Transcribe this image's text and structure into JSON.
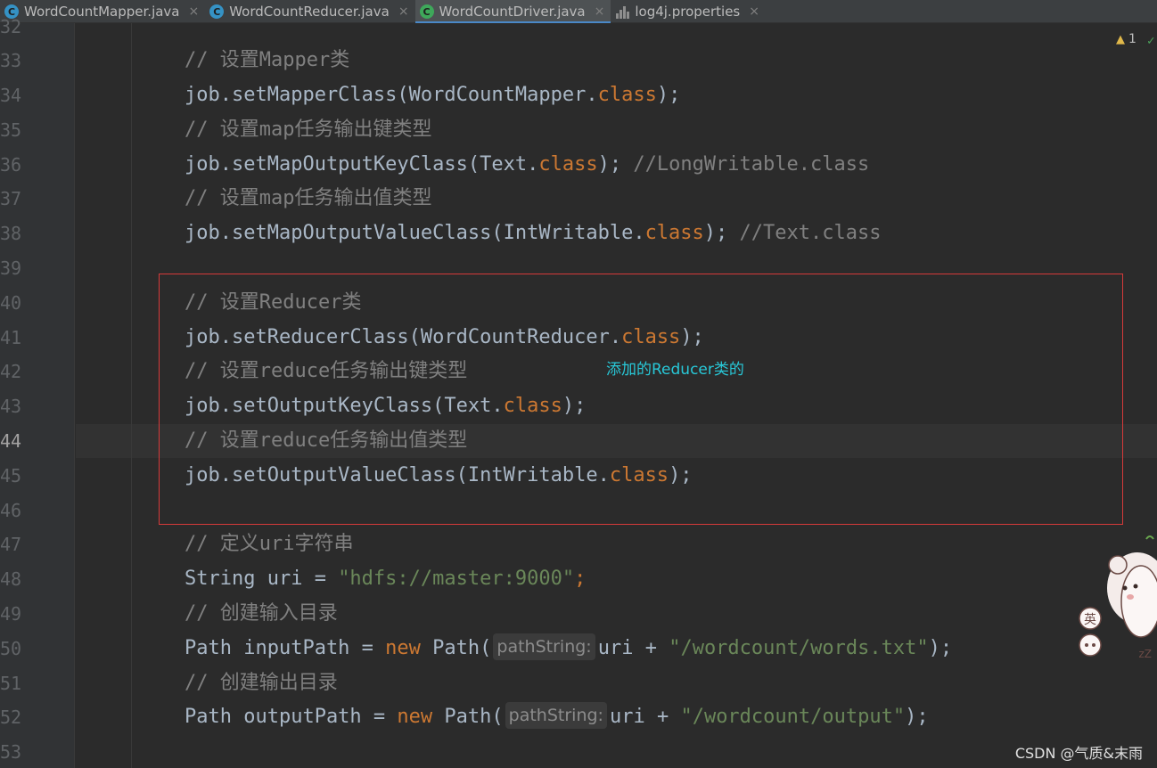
{
  "tabs": [
    {
      "label": "WordCountMapper.java",
      "icon": "C",
      "close": "×"
    },
    {
      "label": "WordCountReducer.java",
      "icon": "C",
      "close": "×"
    },
    {
      "label": "WordCountDriver.java",
      "icon": "C",
      "close": "×",
      "active": true
    },
    {
      "label": "log4j.properties",
      "icon": "properties-file-icon",
      "close": "×"
    }
  ],
  "inspections": {
    "warning_count": "1"
  },
  "gutter": {
    "line_numbers": [
      "32",
      "33",
      "34",
      "35",
      "36",
      "37",
      "38",
      "39",
      "40",
      "41",
      "42",
      "43",
      "44",
      "45",
      "46",
      "47",
      "48",
      "49",
      "50",
      "51",
      "52",
      "53"
    ]
  },
  "code": {
    "l33": {
      "comment": "// 设置Mapper类"
    },
    "l34": {
      "pre": "job.setMapperClass(WordCountMapper.",
      "kw": "class",
      "post": ");"
    },
    "l35": {
      "comment": "// 设置map任务输出键类型"
    },
    "l36": {
      "pre": "job.setMapOutputKeyClass(Text.",
      "kw": "class",
      "post": ");",
      "trail": " //LongWritable.class"
    },
    "l37": {
      "comment": "// 设置map任务输出值类型"
    },
    "l38": {
      "pre": "job.setMapOutputValueClass(IntWritable.",
      "kw": "class",
      "post": ");",
      "trail": " //Text.class"
    },
    "l40": {
      "comment": "// 设置Reducer类"
    },
    "l41": {
      "pre": "job.setReducerClass(WordCountReducer.",
      "kw": "class",
      "post": ");"
    },
    "l42": {
      "comment": "// 设置reduce任务输出键类型"
    },
    "l43": {
      "pre": "job.setOutputKeyClass(Text.",
      "kw": "class",
      "post": ");"
    },
    "l44": {
      "comment": "// 设置reduce任务输出值类型"
    },
    "l45": {
      "pre": "job.setOutputValueClass(IntWritable.",
      "kw": "class",
      "post": ");"
    },
    "l47": {
      "comment": "// 定义uri字符串"
    },
    "l48": {
      "pre": "String uri = ",
      "str": "\"hdfs://master:9000\"",
      "post": ";"
    },
    "l49": {
      "comment": "// 创建输入目录"
    },
    "l50": {
      "pre": "Path inputPath = ",
      "kw": "new",
      "mid": " Path(",
      "hint": "pathString:",
      "mid2": "uri + ",
      "str": "\"/wordcount/words.txt\"",
      "post": ");"
    },
    "l51": {
      "comment": "// 创建输出目录"
    },
    "l52": {
      "pre": "Path outputPath = ",
      "kw": "new",
      "mid": " Path(",
      "hint": "pathString:",
      "mid2": "uri + ",
      "str": "\"/wordcount/output\"",
      "post": ");"
    }
  },
  "annotation": "添加的Reducer类的",
  "sticker_text": {
    "top": "英",
    "bottom": "zZ"
  },
  "watermark": "CSDN @气质&末雨",
  "colors": {
    "annotation": "#28c8d8",
    "highlight_box": "#d63a3a",
    "keyword": "#cc7832",
    "string": "#6a8759",
    "comment": "#808080"
  }
}
